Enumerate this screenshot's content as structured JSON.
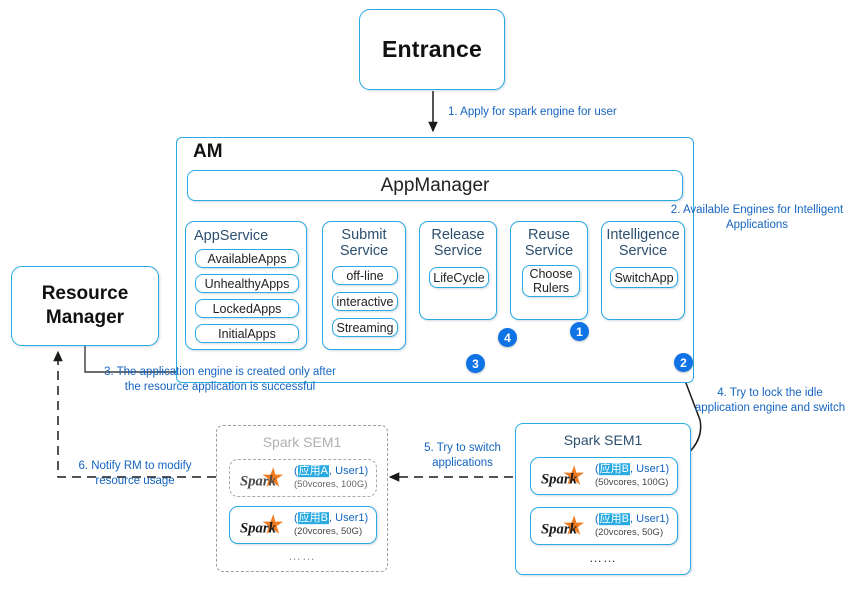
{
  "diagram": {
    "title_entrance": "Entrance",
    "resource_manager": [
      "Resource",
      "Manager"
    ],
    "am_title": "AM",
    "app_manager": "AppManager"
  },
  "services": {
    "app_service": {
      "title": "AppService",
      "items": [
        "AvailableApps",
        "UnhealthyApps",
        "LockedApps",
        "InitialApps"
      ]
    },
    "submit_service": {
      "title": "Submit\nService",
      "title_line1": "Submit",
      "title_line2": "Service",
      "items": [
        "off-line",
        "interactive",
        "Streaming"
      ]
    },
    "release_service": {
      "title_line1": "Release",
      "title_line2": "Service",
      "items": [
        "LifeCycle"
      ]
    },
    "reuse_service": {
      "title_line1": "Reuse",
      "title_line2": "Service",
      "items": [
        "Choose Rulers"
      ]
    },
    "intelligence_service": {
      "title_line1": "Intelligence",
      "title_line2": "Service",
      "items": [
        "SwitchApp"
      ]
    }
  },
  "annotations": {
    "a1": "1. Apply for spark engine for user",
    "a2": "2. Available Engines for Intelligent Applications",
    "a3": "3. The application engine is created only after the resource application is successful",
    "a4": "4. Try to lock the idle application engine and switch",
    "a5": "5. Try to switch applications",
    "a6": "6. Notify RM to modify resource usage"
  },
  "badges": [
    "1",
    "2",
    "3",
    "4"
  ],
  "sem_left": {
    "title": "Spark  SEM1",
    "state": "inactive",
    "apps": [
      {
        "logo": "Spark",
        "name_cn": "应用A",
        "name_rest": ", User1)",
        "prefix": "(",
        "resources": "(50vcores, 100G)",
        "ghost": true
      },
      {
        "logo": "Spark",
        "name_cn": "应用B",
        "name_rest": ", User1)",
        "prefix": "(",
        "resources": "(20vcores, 50G)",
        "ghost": false
      }
    ],
    "ellipsis": "……"
  },
  "sem_right": {
    "title": "Spark SEM1",
    "state": "active",
    "apps": [
      {
        "logo": "Spark",
        "name_cn": "应用B",
        "name_rest": ", User1)",
        "prefix": "(",
        "resources": "(50vcores, 100G)",
        "ghost": false
      },
      {
        "logo": "Spark",
        "name_cn": "应用B",
        "name_rest": ", User1)",
        "prefix": "(",
        "resources": "(20vcores, 50G)",
        "ghost": false
      }
    ],
    "ellipsis": "……"
  },
  "colors": {
    "accent_blue": "#29abe2",
    "badge_blue": "#0f72e5",
    "anno_blue": "#1565c0",
    "title_navy": "#2d4f6e",
    "gray_inactive": "#a8a8a8",
    "spark_orange": "#f07c22",
    "background": "#ffffff"
  }
}
